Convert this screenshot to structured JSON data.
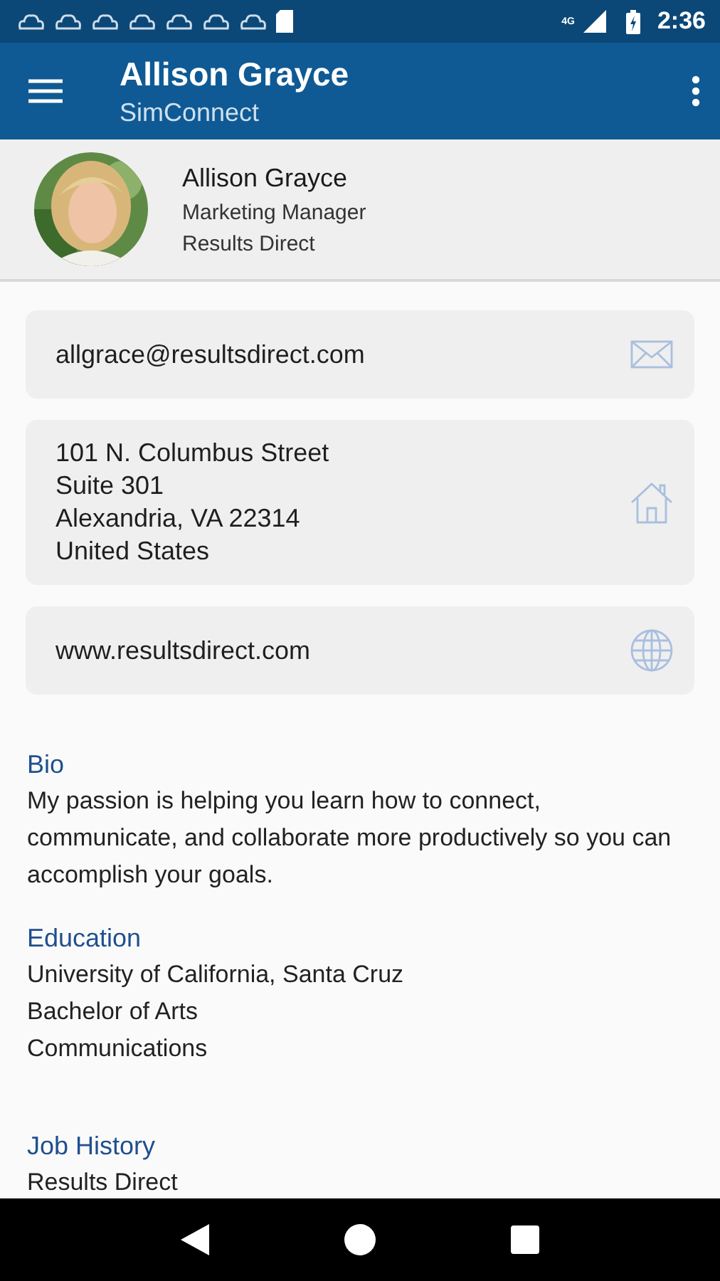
{
  "status_bar": {
    "network": "4G",
    "time": "2:36"
  },
  "app_bar": {
    "title": "Allison Grayce",
    "subtitle": "SimConnect"
  },
  "profile": {
    "name": "Allison Grayce",
    "job_title": "Marketing Manager",
    "company": "Results Direct"
  },
  "contact_cards": [
    {
      "kind": "email",
      "lines": [
        "allgrace@resultsdirect.com"
      ]
    },
    {
      "kind": "address",
      "lines": [
        "101 N. Columbus Street",
        "Suite 301",
        "Alexandria, VA 22314",
        "United States"
      ]
    },
    {
      "kind": "web",
      "lines": [
        "www.resultsdirect.com"
      ]
    }
  ],
  "sections": [
    {
      "heading": "Bio",
      "lines": [
        "My passion is helping you learn how to connect, communicate, and collaborate more productively so you can accomplish your goals."
      ]
    },
    {
      "heading": "Education",
      "lines": [
        "University of California, Santa Cruz",
        "Bachelor of Arts",
        "Communications"
      ]
    },
    {
      "heading": "Job History",
      "lines": [
        "Results Direct"
      ]
    }
  ]
}
